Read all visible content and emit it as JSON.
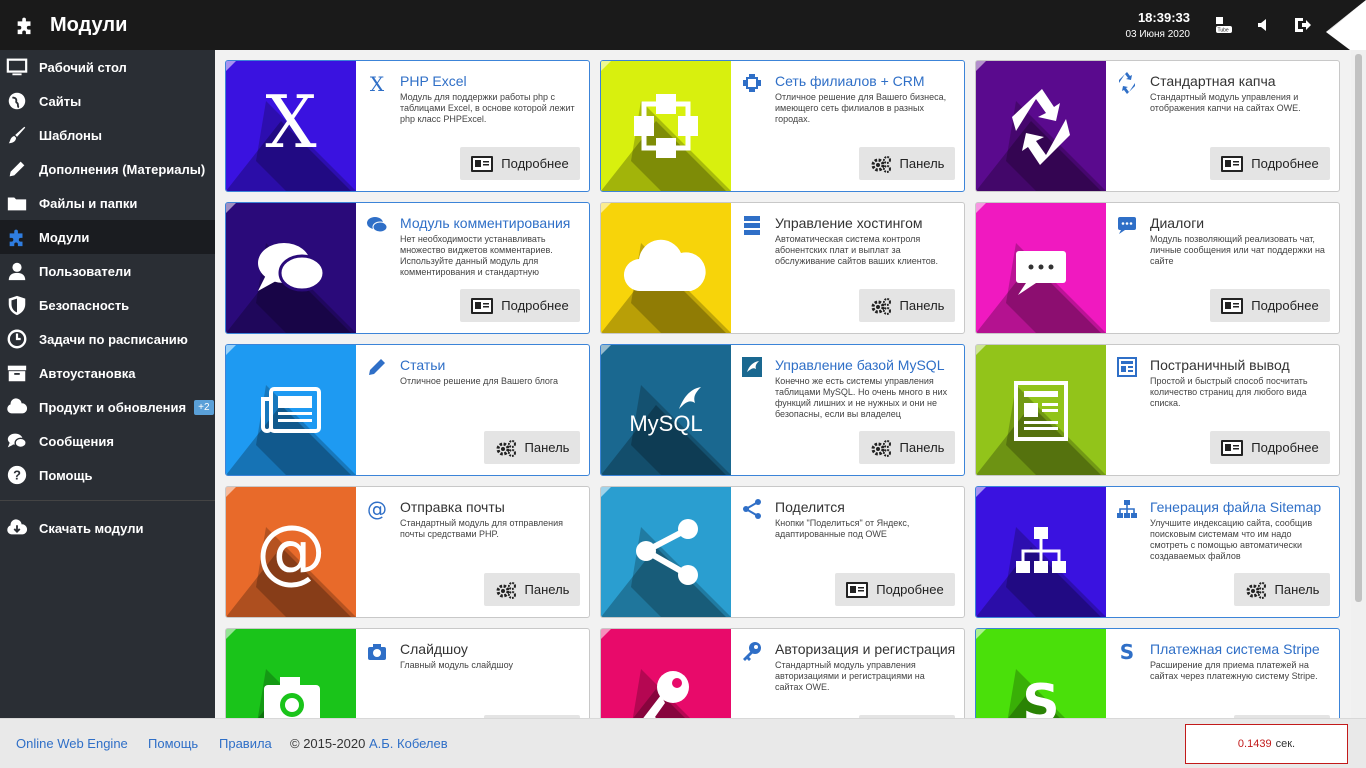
{
  "header": {
    "title": "Модули",
    "time": "18:39:33",
    "date": "03 Июня 2020"
  },
  "sidebar": {
    "items": [
      {
        "label": "Рабочий стол",
        "icon": "monitor-icon"
      },
      {
        "label": "Сайты",
        "icon": "globe-icon"
      },
      {
        "label": "Шаблоны",
        "icon": "brush-icon"
      },
      {
        "label": "Дополнения (Материалы)",
        "icon": "pencil-icon"
      },
      {
        "label": "Файлы и папки",
        "icon": "folder-icon"
      },
      {
        "label": "Модули",
        "icon": "puzzle-icon",
        "active": true
      },
      {
        "label": "Пользователи",
        "icon": "user-icon"
      },
      {
        "label": "Безопасность",
        "icon": "shield-icon"
      },
      {
        "label": "Задачи по расписанию",
        "icon": "clock-icon"
      },
      {
        "label": "Автоустановка",
        "icon": "box-icon"
      },
      {
        "label": "Продукт и обновления",
        "icon": "cloud-icon",
        "badge": "+2"
      },
      {
        "label": "Сообщения",
        "icon": "chat-icon"
      },
      {
        "label": "Помощь",
        "icon": "help-icon"
      }
    ],
    "download_label": "Скачать модули"
  },
  "buttons": {
    "details": "Подробнее",
    "panel": "Панель"
  },
  "cards": [
    {
      "title": "PHP Excel",
      "desc": "Модуль для поддержки работы php с таблицами Excel, в основе которой лежит php класс PHPExcel.",
      "color": "#3a12e0",
      "icon": "excel-icon",
      "button": "details"
    },
    {
      "title": "Сеть филиалов + CRM",
      "desc": "Отличное решение для Вашего бизнеса, имеющего сеть филиалов в разных городах.",
      "color": "#d8f00e",
      "icon": "network-icon",
      "button": "panel"
    },
    {
      "title": "Стандартная капча",
      "desc": "Стандартный модуль управления и отображения капчи на сайтах OWE.",
      "color": "#5a0a8e",
      "icon": "recycle-icon",
      "button": "details"
    },
    {
      "title": "Модуль комментирования",
      "desc": "Нет необходимости устанавливать множество виджетов комментариев. Используйте данный модуль для комментирования и стандартную",
      "color": "#2a0a7a",
      "icon": "comments-icon",
      "button": "details"
    },
    {
      "title": "Управление хостингом",
      "desc": "Автоматическая система контроля абонентских плат и выплат за обслуживание сайтов ваших клиентов.",
      "color": "#f7d40a",
      "icon": "cloud-icon",
      "button": "panel"
    },
    {
      "title": "Диалоги",
      "desc": "Модуль позволяющий реализовать чат, личные сообщения или чат поддержки на сайте",
      "color": "#f019c0",
      "icon": "dialog-icon",
      "button": "details"
    },
    {
      "title": "Статьи",
      "desc": "Отличное решение для Вашего блога",
      "color": "#1e9af2",
      "icon": "newspaper-icon",
      "button": "panel"
    },
    {
      "title": "Управление базой MySQL",
      "desc": "Конечно же есть системы управления таблицами MySQL. Но очень много в них функций лишних и не нужных и они не безопасны, если вы владелец",
      "color": "#1a6890",
      "icon": "mysql-icon",
      "button": "panel",
      "logo_text": "MySQL"
    },
    {
      "title": "Постраничный вывод",
      "desc": "Простой и быстрый способ посчитать количество страниц для любого вида списка.",
      "color": "#92c41a",
      "icon": "pagination-icon",
      "button": "details"
    },
    {
      "title": "Отправка почты",
      "desc": "Стандартный модуль для отправления почты средствами PHP.",
      "color": "#e86a2a",
      "icon": "at-icon",
      "button": "panel"
    },
    {
      "title": "Поделится",
      "desc": "Кнопки \"Поделиться\" от Яндекс, адаптированные под OWE",
      "color": "#2a9ed0",
      "icon": "share-icon",
      "button": "details"
    },
    {
      "title": "Генерация файла Sitemap",
      "desc": "Улучшите индексацию сайта, сообщив поисковым системам что им надо смотреть с помощью автоматически создаваемых файлов",
      "color": "#3a12e0",
      "icon": "sitemap-icon",
      "button": "panel"
    },
    {
      "title": "Слайдшоу",
      "desc": "Главный модуль слайдшоу",
      "color": "#1ac41a",
      "icon": "camera-icon",
      "button": "panel"
    },
    {
      "title": "Авторизация и регистрация",
      "desc": "Стандартный модуль управления авторизациями и регистрациями на сайтах OWE.",
      "color": "#e80a6a",
      "icon": "key-icon",
      "button": "panel"
    },
    {
      "title": "Платежная система Stripe",
      "desc": "Расширение для приема платежей на сайтах через платежную систему Stripe.",
      "color": "#4ae00a",
      "icon": "stripe-icon",
      "button": "panel"
    }
  ],
  "footer": {
    "link1": "Online Web Engine",
    "link2": "Помощь",
    "link3": "Правила",
    "copyright": "© 2015-2020",
    "author": "А.Б. Кобелев",
    "timer_value": "0.1439",
    "timer_unit": "сек."
  }
}
